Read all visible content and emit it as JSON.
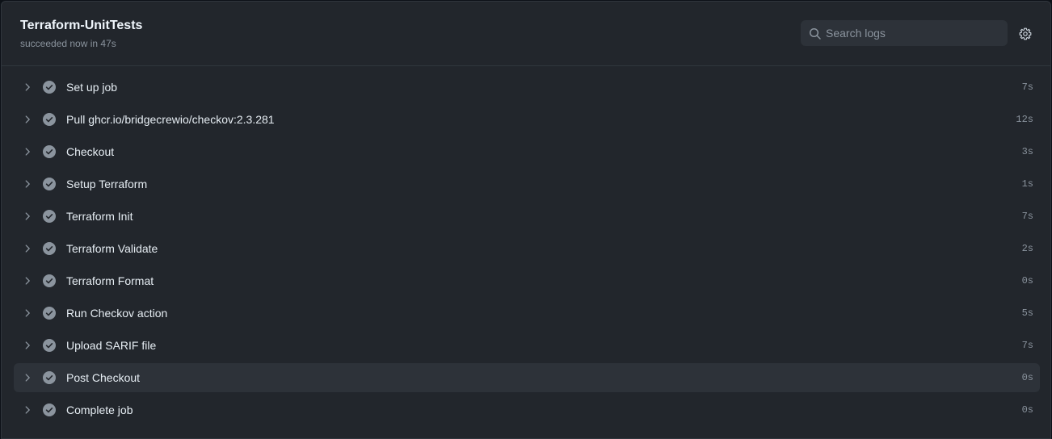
{
  "job": {
    "title": "Terraform-UnitTests",
    "status": "succeeded now in 47s"
  },
  "search": {
    "placeholder": "Search logs",
    "value": ""
  },
  "icons": {
    "search": "search-icon",
    "settings": "gear-icon",
    "expand": "chevron-right-icon",
    "success": "check-circle-icon"
  },
  "colors": {
    "background": "#22262c",
    "success_icon": "#8b949e",
    "text": "#e6edf3",
    "muted": "#8b949e",
    "row_hover": "#2d3239"
  },
  "steps": [
    {
      "name": "Set up job",
      "duration": "7s"
    },
    {
      "name": "Pull ghcr.io/bridgecrewio/checkov:2.3.281",
      "duration": "12s"
    },
    {
      "name": "Checkout",
      "duration": "3s"
    },
    {
      "name": "Setup Terraform",
      "duration": "1s"
    },
    {
      "name": "Terraform Init",
      "duration": "7s"
    },
    {
      "name": "Terraform Validate",
      "duration": "2s"
    },
    {
      "name": "Terraform Format",
      "duration": "0s"
    },
    {
      "name": "Run Checkov action",
      "duration": "5s"
    },
    {
      "name": "Upload SARIF file",
      "duration": "7s"
    },
    {
      "name": "Post Checkout",
      "duration": "0s",
      "highlighted": true
    },
    {
      "name": "Complete job",
      "duration": "0s"
    }
  ]
}
